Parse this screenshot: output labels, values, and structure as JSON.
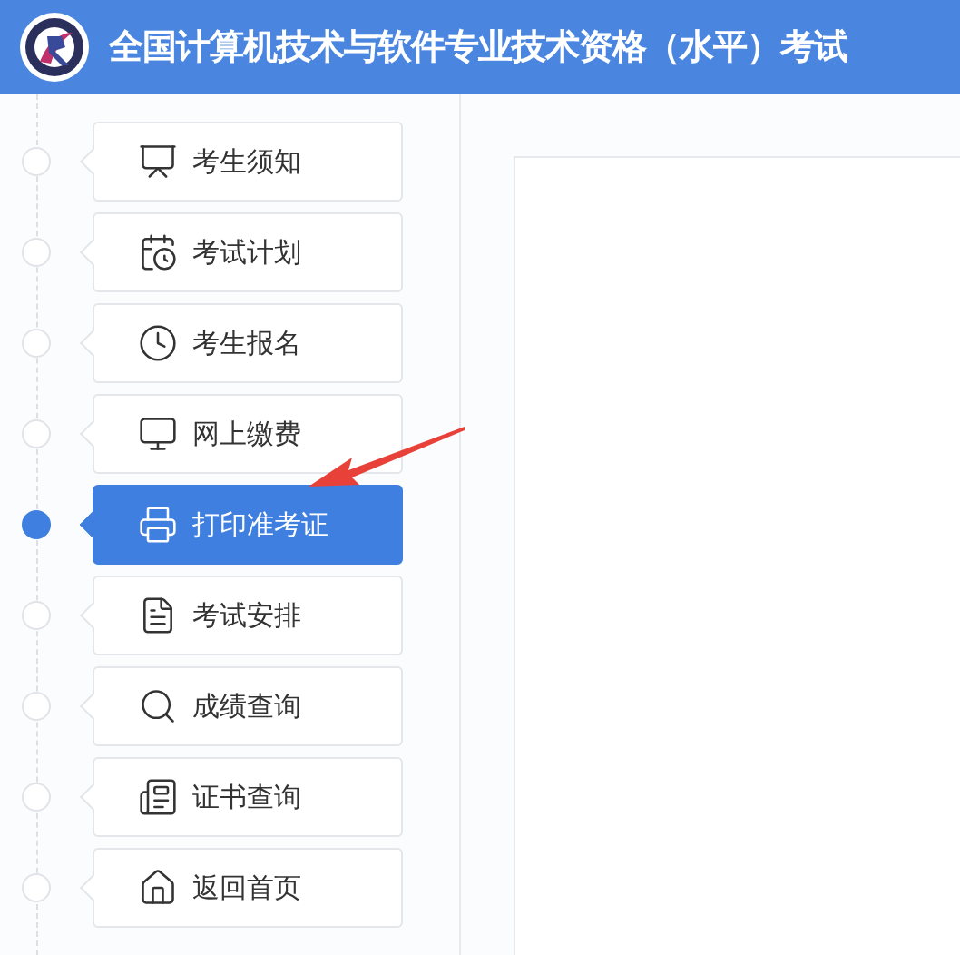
{
  "header": {
    "title": "全国计算机技术与软件专业技术资格（水平）考试"
  },
  "sidebar": {
    "items": [
      {
        "label": "考生须知",
        "selected": false
      },
      {
        "label": "考试计划",
        "selected": false
      },
      {
        "label": "考生报名",
        "selected": false
      },
      {
        "label": "网上缴费",
        "selected": false
      },
      {
        "label": "打印准考证",
        "selected": true
      },
      {
        "label": "考试安排",
        "selected": false
      },
      {
        "label": "成绩查询",
        "selected": false
      },
      {
        "label": "证书查询",
        "selected": false
      },
      {
        "label": "返回首页",
        "selected": false
      }
    ]
  }
}
